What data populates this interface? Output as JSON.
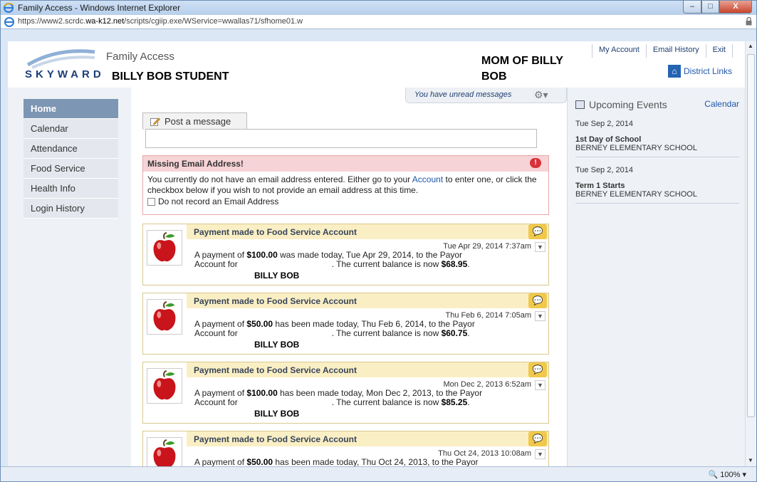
{
  "window": {
    "title": "Family Access - Windows Internet Explorer",
    "url_prefix": "https://www2.scrdc.",
    "url_domain": "wa-k12.net",
    "url_path": "/scripts/cgiip.exe/WService=wwallas71/sfhome01.w",
    "min_label": "–",
    "max_label": "□",
    "close_label": "X",
    "zoom": "100%"
  },
  "header": {
    "logo_text": "SKYWARD",
    "app_title": "Family Access",
    "student_name": "BILLY BOB STUDENT",
    "parent_name": "MOM OF BILLY BOB",
    "top_links": [
      "My Account",
      "Email History",
      "Exit"
    ],
    "district_links": "District Links"
  },
  "sidebar": {
    "items": [
      {
        "label": "Home",
        "active": true
      },
      {
        "label": "Calendar",
        "active": false
      },
      {
        "label": "Attendance",
        "active": false
      },
      {
        "label": "Food Service",
        "active": false
      },
      {
        "label": "Health Info",
        "active": false
      },
      {
        "label": "Login History",
        "active": false
      }
    ]
  },
  "messages": {
    "unread": "You have unread messages",
    "post_tab": "Post a message"
  },
  "alert": {
    "title": "Missing Email Address!",
    "text_1": "You currently do not have an email address entered. Either go to your ",
    "link": "Account",
    "text_2": " to enter one, or click the checkbox below if you wish to not provide an email address at this time.",
    "checkbox_label": "Do not record an Email Address"
  },
  "cards": [
    {
      "title": "Payment made to Food Service Account",
      "date": "Tue Apr 29, 2014 7:37am",
      "line_a": "A payment of ",
      "amount": "$100.00",
      "line_b": " was made today, Tue Apr 29, 2014, to the Payor",
      "line_c": "Account for",
      "line_d": ". The current balance is now ",
      "balance": "$68.95",
      "line_e": ".",
      "name": "BILLY BOB"
    },
    {
      "title": "Payment made to Food Service Account",
      "date": "Thu Feb 6, 2014 7:05am",
      "line_a": "A payment of ",
      "amount": "$50.00",
      "line_b": " has been made today, Thu Feb 6, 2014, to the Payor",
      "line_c": "Account for",
      "line_d": ". The current balance is now ",
      "balance": "$60.75",
      "line_e": ".",
      "name": "BILLY BOB"
    },
    {
      "title": "Payment made to Food Service Account",
      "date": "Mon Dec 2, 2013 6:52am",
      "line_a": "A payment of ",
      "amount": "$100.00",
      "line_b": " has been made today, Mon Dec 2, 2013, to the Payor",
      "line_c": "Account for",
      "line_d": ". The current balance is now ",
      "balance": "$85.25",
      "line_e": ".",
      "name": "BILLY BOB"
    },
    {
      "title": "Payment made to Food Service Account",
      "date": "Thu Oct 24, 2013 10:08am",
      "line_a": "A payment of ",
      "amount": "$50.00",
      "line_b": " has been made today, Thu Oct 24, 2013, to the Payor",
      "line_c": "",
      "line_d": "",
      "balance": "",
      "line_e": "",
      "name": ""
    }
  ],
  "events": {
    "title": "Upcoming Events",
    "calendar_link": "Calendar",
    "items": [
      {
        "date": "Tue Sep 2, 2014",
        "name": "1st Day of School",
        "school": "BERNEY ELEMENTARY SCHOOL"
      },
      {
        "date": "Tue Sep 2, 2014",
        "name": "Term 1 Starts",
        "school": "BERNEY ELEMENTARY SCHOOL"
      }
    ]
  }
}
